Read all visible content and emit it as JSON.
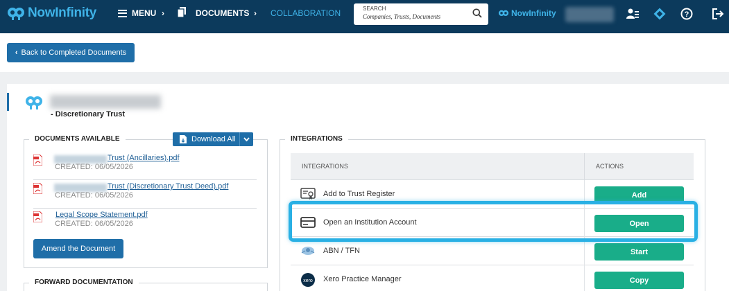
{
  "topbar": {
    "brand": "NowInfinity",
    "menu_label": "MENU",
    "breadcrumb": [
      "DOCUMENTS",
      "COLLABORATION"
    ],
    "search_label": "SEARCH",
    "search_placeholder": "Companies,  Trusts,  Documents",
    "brand_secondary": "NowInfinity",
    "icons": [
      "user-list-icon",
      "diamond-icon",
      "help-icon",
      "logout-icon"
    ],
    "colors": {
      "bar": "#0c3a5c",
      "brand": "#3fb3e8",
      "active_crumb": "#3fb3e8"
    }
  },
  "actions": {
    "back_label": "Back to Completed Documents"
  },
  "entity": {
    "subtitle": "- Discretionary Trust"
  },
  "documents_panel": {
    "title": "DOCUMENTS AVAILABLE",
    "download_label": "Download All",
    "documents": [
      {
        "name": "Trust (Ancillaries).pdf",
        "created": "CREATED: 06/05/2026"
      },
      {
        "name": "Trust (Discretionary Trust Deed).pdf",
        "created": "CREATED: 06/05/2026"
      },
      {
        "name": "Legal Scope Statement.pdf",
        "created": "CREATED: 06/05/2026"
      }
    ],
    "amend_label": "Amend the Document"
  },
  "forward_panel": {
    "title": "FORWARD DOCUMENTATION"
  },
  "integrations_panel": {
    "title": "INTEGRATIONS",
    "headers": {
      "integration": "INTEGRATIONS",
      "actions": "ACTIONS"
    },
    "rows": [
      {
        "label": "Add to Trust Register",
        "action": "Add",
        "icon": "certificate-icon"
      },
      {
        "label": "Open an Institution Account",
        "action": "Open",
        "icon": "card-icon"
      },
      {
        "label": "ABN / TFN",
        "action": "Start",
        "icon": "abn-crest-icon"
      },
      {
        "label": "Xero Practice Manager",
        "action": "Copy",
        "icon": "xero-icon"
      }
    ],
    "colors": {
      "action_button": "#19ad89",
      "highlight": "#29b0e4"
    }
  }
}
